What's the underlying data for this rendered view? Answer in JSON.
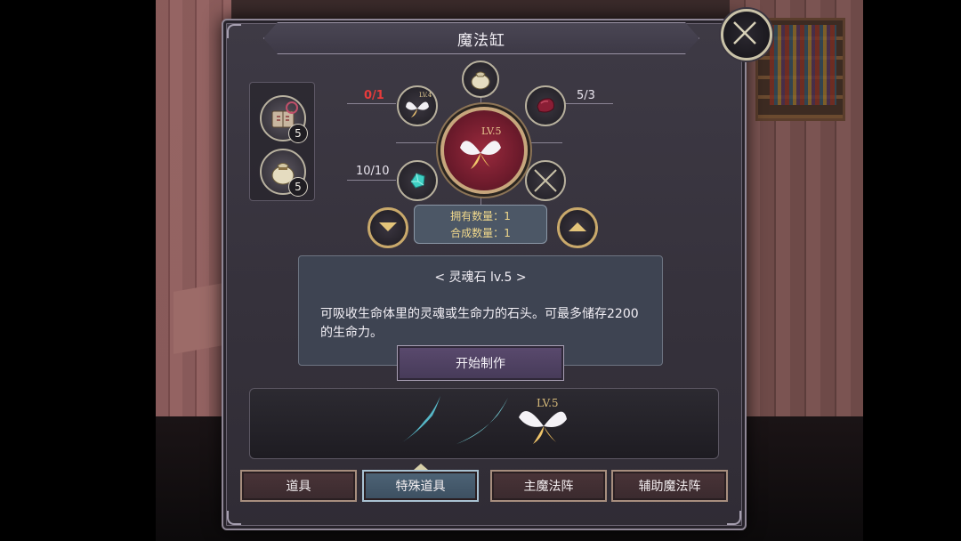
{
  "window": {
    "title": "魔法缸",
    "close_icon": "close-icon"
  },
  "inventory": {
    "items": [
      {
        "icon": "spellbook-icon",
        "count": "5"
      },
      {
        "icon": "pouch-icon",
        "count": "5"
      }
    ]
  },
  "recipe": {
    "materials": [
      {
        "icon": "fairy-wing-icon",
        "level": "LV.4",
        "count": "0/1",
        "insufficient": true
      },
      {
        "icon": "pouch-icon",
        "count": ""
      },
      {
        "icon": "red-gem-icon",
        "count": "5/3"
      },
      {
        "icon": "cyan-crystal-icon",
        "count": "10/10"
      },
      {
        "icon": "empty-slot-icon",
        "count": ""
      }
    ],
    "result": {
      "icon": "soul-stone-icon",
      "level": "LV.5"
    },
    "owned_label": "拥有数量：",
    "owned_value": "1",
    "craft_label": "合成数量：",
    "craft_value": "1",
    "prev_icon": "chevron-down-icon",
    "next_icon": "chevron-up-icon"
  },
  "description": {
    "title": "< 灵魂石 lv.5 >",
    "text": "可吸收生命体里的灵魂或生命力的石头。可最多储存2200的生命力。"
  },
  "craft_button": "开始制作",
  "preview": {
    "level": "LV.5"
  },
  "tabs": [
    {
      "label": "道具",
      "active": false
    },
    {
      "label": "特殊道具",
      "active": true
    },
    {
      "label": "主魔法阵",
      "active": false
    },
    {
      "label": "辅助魔法阵",
      "active": false
    }
  ],
  "colors": {
    "accent_gold": "#c9a96b",
    "insufficient_red": "#e83b3b",
    "active_tab": "#4e6477"
  }
}
